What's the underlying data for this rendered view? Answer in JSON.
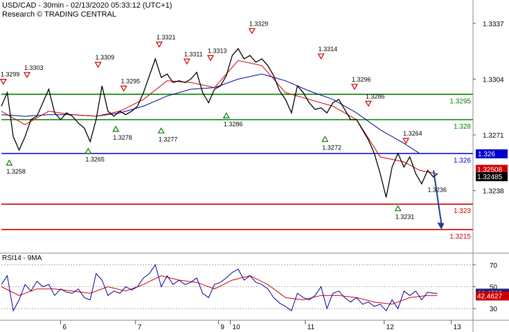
{
  "header": {
    "title": "USD/CAD - 30min - 02/13/2020 05:33:12 (UTC+1)",
    "subtitle": "Research © TRADING CENTRAL"
  },
  "rsi_panel": {
    "title": "RSI14 - 9MA"
  },
  "colors": {
    "support_resistance": "#008000",
    "pivot": "#0000cc",
    "target": "#cc0000",
    "fast_ma": "#cc0000",
    "slow_ma": "#000099",
    "price": "#000000",
    "up_marker": "#008000",
    "down_marker": "#cc0000",
    "arrow": "#1f3a99"
  },
  "chart_data": [
    {
      "type": "line",
      "title": "USD/CAD - 30min",
      "ylim": [
        1.3201,
        1.335
      ],
      "x_ticks": [
        "6",
        "7",
        "9",
        "10",
        "11",
        "12",
        "13"
      ],
      "y_ticks": [
        "1.3337",
        "1.3304",
        "1.3271",
        "1.3238"
      ],
      "last_price": "1.32485",
      "second_price": "1.32508",
      "horizontal_levels": [
        {
          "value": 1.3295,
          "label": "1.3295",
          "kind": "resistance"
        },
        {
          "value": 1.328,
          "label": "1.328",
          "kind": "resistance"
        },
        {
          "value": 1.326,
          "label": "1.326",
          "kind": "pivot"
        },
        {
          "value": 1.323,
          "label": "1.323",
          "kind": "target"
        },
        {
          "value": 1.3215,
          "label": "1.3215",
          "kind": "target"
        }
      ],
      "price_series": [
        {
          "x": 0,
          "y": 1.3288
        },
        {
          "x": 3,
          "y": 1.3296
        },
        {
          "x": 6,
          "y": 1.327
        },
        {
          "x": 9,
          "y": 1.3262
        },
        {
          "x": 12,
          "y": 1.327
        },
        {
          "x": 15,
          "y": 1.328
        },
        {
          "x": 18,
          "y": 1.3282
        },
        {
          "x": 21,
          "y": 1.329
        },
        {
          "x": 24,
          "y": 1.3298
        },
        {
          "x": 27,
          "y": 1.3284
        },
        {
          "x": 30,
          "y": 1.328
        },
        {
          "x": 33,
          "y": 1.3284
        },
        {
          "x": 36,
          "y": 1.3282
        },
        {
          "x": 39,
          "y": 1.3278
        },
        {
          "x": 42,
          "y": 1.3275
        },
        {
          "x": 45,
          "y": 1.3267
        },
        {
          "x": 48,
          "y": 1.328
        },
        {
          "x": 51,
          "y": 1.33
        },
        {
          "x": 54,
          "y": 1.3285
        },
        {
          "x": 57,
          "y": 1.3282
        },
        {
          "x": 60,
          "y": 1.3285
        },
        {
          "x": 63,
          "y": 1.3283
        },
        {
          "x": 66,
          "y": 1.3285
        },
        {
          "x": 69,
          "y": 1.3288
        },
        {
          "x": 72,
          "y": 1.3296
        },
        {
          "x": 75,
          "y": 1.3306
        },
        {
          "x": 78,
          "y": 1.3316
        },
        {
          "x": 81,
          "y": 1.3305
        },
        {
          "x": 84,
          "y": 1.3307
        },
        {
          "x": 87,
          "y": 1.3302
        },
        {
          "x": 90,
          "y": 1.3303
        },
        {
          "x": 93,
          "y": 1.3302
        },
        {
          "x": 96,
          "y": 1.3304
        },
        {
          "x": 99,
          "y": 1.3308
        },
        {
          "x": 102,
          "y": 1.3296
        },
        {
          "x": 105,
          "y": 1.329
        },
        {
          "x": 108,
          "y": 1.3298
        },
        {
          "x": 111,
          "y": 1.33
        },
        {
          "x": 114,
          "y": 1.3306
        },
        {
          "x": 117,
          "y": 1.3318
        },
        {
          "x": 120,
          "y": 1.3322
        },
        {
          "x": 123,
          "y": 1.3316
        },
        {
          "x": 126,
          "y": 1.3318
        },
        {
          "x": 129,
          "y": 1.3314
        },
        {
          "x": 132,
          "y": 1.3316
        },
        {
          "x": 135,
          "y": 1.3312
        },
        {
          "x": 138,
          "y": 1.3306
        },
        {
          "x": 141,
          "y": 1.3297
        },
        {
          "x": 144,
          "y": 1.3292
        },
        {
          "x": 147,
          "y": 1.3284
        },
        {
          "x": 150,
          "y": 1.33
        },
        {
          "x": 153,
          "y": 1.3296
        },
        {
          "x": 156,
          "y": 1.329
        },
        {
          "x": 159,
          "y": 1.3286
        },
        {
          "x": 162,
          "y": 1.3287
        },
        {
          "x": 165,
          "y": 1.3284
        },
        {
          "x": 168,
          "y": 1.329
        },
        {
          "x": 171,
          "y": 1.3292
        },
        {
          "x": 174,
          "y": 1.3286
        },
        {
          "x": 177,
          "y": 1.328
        },
        {
          "x": 180,
          "y": 1.328
        },
        {
          "x": 183,
          "y": 1.3274
        },
        {
          "x": 186,
          "y": 1.3268
        },
        {
          "x": 189,
          "y": 1.326
        },
        {
          "x": 192,
          "y": 1.3248
        },
        {
          "x": 195,
          "y": 1.3234
        },
        {
          "x": 198,
          "y": 1.3252
        },
        {
          "x": 201,
          "y": 1.326
        },
        {
          "x": 204,
          "y": 1.3252
        },
        {
          "x": 207,
          "y": 1.3258
        },
        {
          "x": 210,
          "y": 1.3248
        },
        {
          "x": 213,
          "y": 1.3242
        },
        {
          "x": 216,
          "y": 1.325
        },
        {
          "x": 219,
          "y": 1.3246
        },
        {
          "x": 221,
          "y": 1.3248
        }
      ],
      "fast_ma": [
        {
          "x": 0,
          "y": 1.3285
        },
        {
          "x": 12,
          "y": 1.3277
        },
        {
          "x": 24,
          "y": 1.3285
        },
        {
          "x": 36,
          "y": 1.3283
        },
        {
          "x": 48,
          "y": 1.3282
        },
        {
          "x": 60,
          "y": 1.3285
        },
        {
          "x": 72,
          "y": 1.3292
        },
        {
          "x": 84,
          "y": 1.3303
        },
        {
          "x": 96,
          "y": 1.3302
        },
        {
          "x": 108,
          "y": 1.3299
        },
        {
          "x": 120,
          "y": 1.3315
        },
        {
          "x": 132,
          "y": 1.3312
        },
        {
          "x": 144,
          "y": 1.3296
        },
        {
          "x": 156,
          "y": 1.3292
        },
        {
          "x": 168,
          "y": 1.3288
        },
        {
          "x": 180,
          "y": 1.328
        },
        {
          "x": 192,
          "y": 1.3258
        },
        {
          "x": 204,
          "y": 1.3255
        },
        {
          "x": 212,
          "y": 1.325
        },
        {
          "x": 221,
          "y": 1.3248
        }
      ],
      "slow_ma": [
        {
          "x": 0,
          "y": 1.3283
        },
        {
          "x": 12,
          "y": 1.3282
        },
        {
          "x": 24,
          "y": 1.3283
        },
        {
          "x": 36,
          "y": 1.3283
        },
        {
          "x": 48,
          "y": 1.3282
        },
        {
          "x": 60,
          "y": 1.3284
        },
        {
          "x": 72,
          "y": 1.3288
        },
        {
          "x": 84,
          "y": 1.3294
        },
        {
          "x": 96,
          "y": 1.3298
        },
        {
          "x": 108,
          "y": 1.3299
        },
        {
          "x": 120,
          "y": 1.3304
        },
        {
          "x": 132,
          "y": 1.3307
        },
        {
          "x": 144,
          "y": 1.3303
        },
        {
          "x": 156,
          "y": 1.3297
        },
        {
          "x": 168,
          "y": 1.3292
        },
        {
          "x": 180,
          "y": 1.3284
        },
        {
          "x": 192,
          "y": 1.3274
        },
        {
          "x": 204,
          "y": 1.3266
        },
        {
          "x": 212,
          "y": 1.326
        }
      ],
      "swing_labels": [
        {
          "x": 1,
          "y": 1.3299,
          "label": "1.3299",
          "dir": "down"
        },
        {
          "x": 4,
          "y": 1.3258,
          "label": "1.3258",
          "dir": "up"
        },
        {
          "x": 13,
          "y": 1.3303,
          "label": "1.3303",
          "dir": "down"
        },
        {
          "x": 44,
          "y": 1.3265,
          "label": "1.3265",
          "dir": "up"
        },
        {
          "x": 49,
          "y": 1.3309,
          "label": "1.3309",
          "dir": "down"
        },
        {
          "x": 58,
          "y": 1.3278,
          "label": "1.3278",
          "dir": "up"
        },
        {
          "x": 62,
          "y": 1.3295,
          "label": "1.3295",
          "dir": "down"
        },
        {
          "x": 80,
          "y": 1.3321,
          "label": "1.3321",
          "dir": "down"
        },
        {
          "x": 81,
          "y": 1.3277,
          "label": "1.3277",
          "dir": "up"
        },
        {
          "x": 94,
          "y": 1.3311,
          "label": "1.3311",
          "dir": "down"
        },
        {
          "x": 106,
          "y": 1.3313,
          "label": "1.3313",
          "dir": "down"
        },
        {
          "x": 114,
          "y": 1.3286,
          "label": "1.3286",
          "dir": "up"
        },
        {
          "x": 127,
          "y": 1.3329,
          "label": "1.3329",
          "dir": "down"
        },
        {
          "x": 162,
          "y": 1.3314,
          "label": "1.3314",
          "dir": "down"
        },
        {
          "x": 164,
          "y": 1.3272,
          "label": "1.3272",
          "dir": "up"
        },
        {
          "x": 179,
          "y": 1.3296,
          "label": "1.3296",
          "dir": "down"
        },
        {
          "x": 186,
          "y": 1.3286,
          "label": "1.3286",
          "dir": "down"
        },
        {
          "x": 205,
          "y": 1.3264,
          "label": "1.3264",
          "dir": "down"
        },
        {
          "x": 201,
          "y": 1.3231,
          "label": "1.3231",
          "dir": "up"
        },
        {
          "x": 216,
          "y": 1.3236,
          "label": "1.3236",
          "dir": "none"
        }
      ],
      "projection": {
        "from_x": 219,
        "from_y": 1.325,
        "to_x": 223,
        "to_y": 1.3215
      }
    },
    {
      "type": "line",
      "title": "RSI14 - 9MA",
      "ylim": [
        20,
        80
      ],
      "y_ticks": [
        "70",
        "50",
        "30"
      ],
      "reference_lines": [
        70,
        50,
        30
      ],
      "last_rsi": "44.4002",
      "last_ma": "42.4627",
      "rsi": [
        {
          "x": 0,
          "y": 52
        },
        {
          "x": 3,
          "y": 60
        },
        {
          "x": 6,
          "y": 28
        },
        {
          "x": 9,
          "y": 38
        },
        {
          "x": 12,
          "y": 52
        },
        {
          "x": 15,
          "y": 46
        },
        {
          "x": 18,
          "y": 55
        },
        {
          "x": 21,
          "y": 50
        },
        {
          "x": 24,
          "y": 52
        },
        {
          "x": 27,
          "y": 42
        },
        {
          "x": 30,
          "y": 48
        },
        {
          "x": 33,
          "y": 45
        },
        {
          "x": 36,
          "y": 44
        },
        {
          "x": 39,
          "y": 48
        },
        {
          "x": 42,
          "y": 40
        },
        {
          "x": 45,
          "y": 38
        },
        {
          "x": 48,
          "y": 62
        },
        {
          "x": 51,
          "y": 56
        },
        {
          "x": 54,
          "y": 42
        },
        {
          "x": 57,
          "y": 46
        },
        {
          "x": 60,
          "y": 44
        },
        {
          "x": 63,
          "y": 50
        },
        {
          "x": 66,
          "y": 47
        },
        {
          "x": 69,
          "y": 50
        },
        {
          "x": 72,
          "y": 58
        },
        {
          "x": 75,
          "y": 62
        },
        {
          "x": 78,
          "y": 70
        },
        {
          "x": 81,
          "y": 50
        },
        {
          "x": 84,
          "y": 60
        },
        {
          "x": 87,
          "y": 52
        },
        {
          "x": 90,
          "y": 56
        },
        {
          "x": 93,
          "y": 52
        },
        {
          "x": 96,
          "y": 54
        },
        {
          "x": 99,
          "y": 58
        },
        {
          "x": 102,
          "y": 44
        },
        {
          "x": 105,
          "y": 40
        },
        {
          "x": 108,
          "y": 52
        },
        {
          "x": 111,
          "y": 54
        },
        {
          "x": 114,
          "y": 58
        },
        {
          "x": 117,
          "y": 63
        },
        {
          "x": 120,
          "y": 66
        },
        {
          "x": 123,
          "y": 56
        },
        {
          "x": 126,
          "y": 60
        },
        {
          "x": 129,
          "y": 54
        },
        {
          "x": 132,
          "y": 52
        },
        {
          "x": 135,
          "y": 48
        },
        {
          "x": 138,
          "y": 40
        },
        {
          "x": 141,
          "y": 35
        },
        {
          "x": 144,
          "y": 32
        },
        {
          "x": 147,
          "y": 28
        },
        {
          "x": 150,
          "y": 44
        },
        {
          "x": 153,
          "y": 40
        },
        {
          "x": 156,
          "y": 38
        },
        {
          "x": 159,
          "y": 42
        },
        {
          "x": 162,
          "y": 50
        },
        {
          "x": 165,
          "y": 30
        },
        {
          "x": 168,
          "y": 44
        },
        {
          "x": 171,
          "y": 46
        },
        {
          "x": 174,
          "y": 40
        },
        {
          "x": 177,
          "y": 36
        },
        {
          "x": 180,
          "y": 40
        },
        {
          "x": 183,
          "y": 34
        },
        {
          "x": 186,
          "y": 36
        },
        {
          "x": 189,
          "y": 32
        },
        {
          "x": 192,
          "y": 34
        },
        {
          "x": 195,
          "y": 28
        },
        {
          "x": 198,
          "y": 38
        },
        {
          "x": 201,
          "y": 30
        },
        {
          "x": 204,
          "y": 46
        },
        {
          "x": 207,
          "y": 42
        },
        {
          "x": 210,
          "y": 46
        },
        {
          "x": 213,
          "y": 38
        },
        {
          "x": 216,
          "y": 45
        },
        {
          "x": 219,
          "y": 44
        },
        {
          "x": 221,
          "y": 44
        }
      ],
      "rsi_ma": [
        {
          "x": 0,
          "y": 50
        },
        {
          "x": 9,
          "y": 42
        },
        {
          "x": 18,
          "y": 48
        },
        {
          "x": 27,
          "y": 48
        },
        {
          "x": 36,
          "y": 46
        },
        {
          "x": 45,
          "y": 44
        },
        {
          "x": 54,
          "y": 50
        },
        {
          "x": 63,
          "y": 46
        },
        {
          "x": 72,
          "y": 52
        },
        {
          "x": 81,
          "y": 60
        },
        {
          "x": 90,
          "y": 56
        },
        {
          "x": 99,
          "y": 54
        },
        {
          "x": 108,
          "y": 48
        },
        {
          "x": 117,
          "y": 56
        },
        {
          "x": 126,
          "y": 60
        },
        {
          "x": 135,
          "y": 52
        },
        {
          "x": 144,
          "y": 40
        },
        {
          "x": 153,
          "y": 38
        },
        {
          "x": 162,
          "y": 42
        },
        {
          "x": 171,
          "y": 42
        },
        {
          "x": 180,
          "y": 40
        },
        {
          "x": 189,
          "y": 36
        },
        {
          "x": 198,
          "y": 34
        },
        {
          "x": 207,
          "y": 40
        },
        {
          "x": 216,
          "y": 42
        },
        {
          "x": 221,
          "y": 42
        }
      ]
    }
  ]
}
